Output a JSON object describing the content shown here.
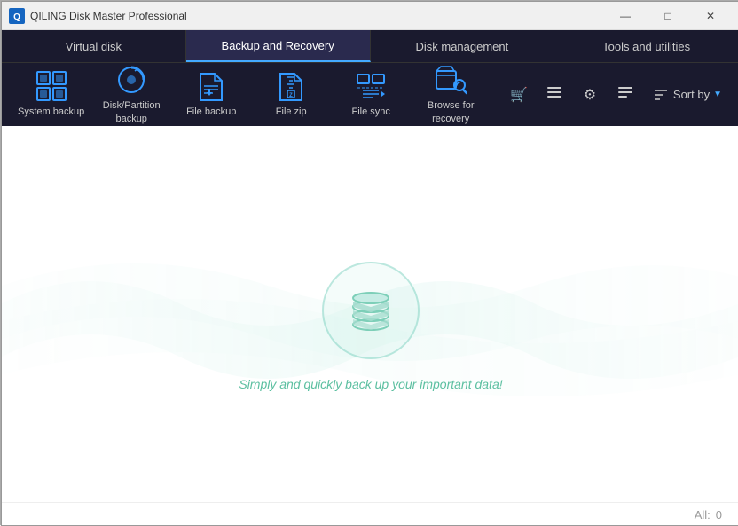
{
  "titlebar": {
    "title": "QILING Disk Master Professional",
    "min_btn": "—",
    "max_btn": "□",
    "close_btn": "✕"
  },
  "main_tabs": [
    {
      "id": "virtual-disk",
      "label": "Virtual disk",
      "active": false
    },
    {
      "id": "backup-recovery",
      "label": "Backup and Recovery",
      "active": true
    },
    {
      "id": "disk-management",
      "label": "Disk management",
      "active": false
    },
    {
      "id": "tools-utilities",
      "label": "Tools and utilities",
      "active": false
    }
  ],
  "icon_tools": [
    {
      "id": "system-backup",
      "label": "System backup",
      "icon": "system-backup-icon"
    },
    {
      "id": "disk-partition-backup",
      "label": "Disk/Partition\nbackup",
      "icon": "disk-partition-icon"
    },
    {
      "id": "file-backup",
      "label": "File backup",
      "icon": "file-backup-icon"
    },
    {
      "id": "file-zip",
      "label": "File zip",
      "icon": "file-zip-icon"
    },
    {
      "id": "file-sync",
      "label": "File sync",
      "icon": "file-sync-icon"
    },
    {
      "id": "browse-recovery",
      "label": "Browse for\nrecovery",
      "icon": "browse-recovery-icon"
    }
  ],
  "toolbar_right": {
    "cart_icon": "🛒",
    "list_icon": "☰",
    "gear_icon": "⚙",
    "menu_icon": "≡",
    "sort_label": "Sort by"
  },
  "content": {
    "tagline": "Simply and quickly back up your important data!"
  },
  "footer": {
    "all_label": "All:",
    "all_count": "0"
  }
}
